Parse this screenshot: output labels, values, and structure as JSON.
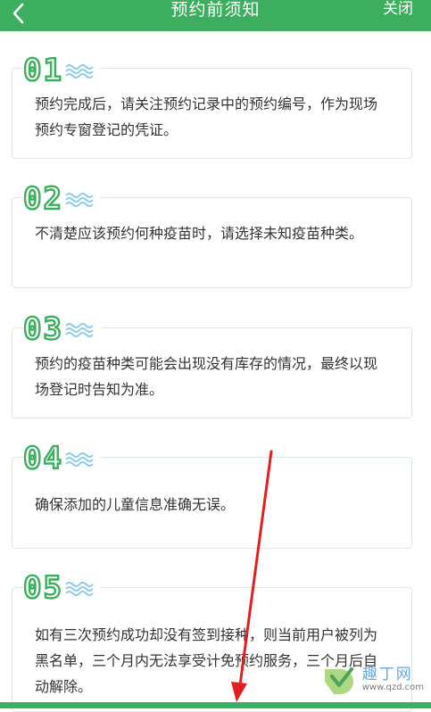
{
  "header": {
    "title": "预约前须知",
    "close_label": "关闭"
  },
  "notices": [
    {
      "num": "01",
      "text": "预约完成后，请关注预约记录中的预约编号，作为现场预约专窗登记的凭证。"
    },
    {
      "num": "02",
      "text": "不清楚应该预约何种疫苗时，请选择未知疫苗种类。"
    },
    {
      "num": "03",
      "text": "预约的疫苗种类可能会出现没有库存的情况，最终以现场登记时告知为准。"
    },
    {
      "num": "04",
      "text": "确保添加的儿童信息准确无误。"
    },
    {
      "num": "05",
      "text": "如有三次预约成功却没有签到接种，则当前用户被列为黑名单，三个月内无法享受计免预约服务，三个月后自动解除。"
    }
  ],
  "watermark": {
    "text": "趣丁网",
    "url": "www.qzd.com"
  },
  "colors": {
    "brand": "#3dae5f",
    "wave": "#8fcde6",
    "arrow": "#e02020"
  }
}
